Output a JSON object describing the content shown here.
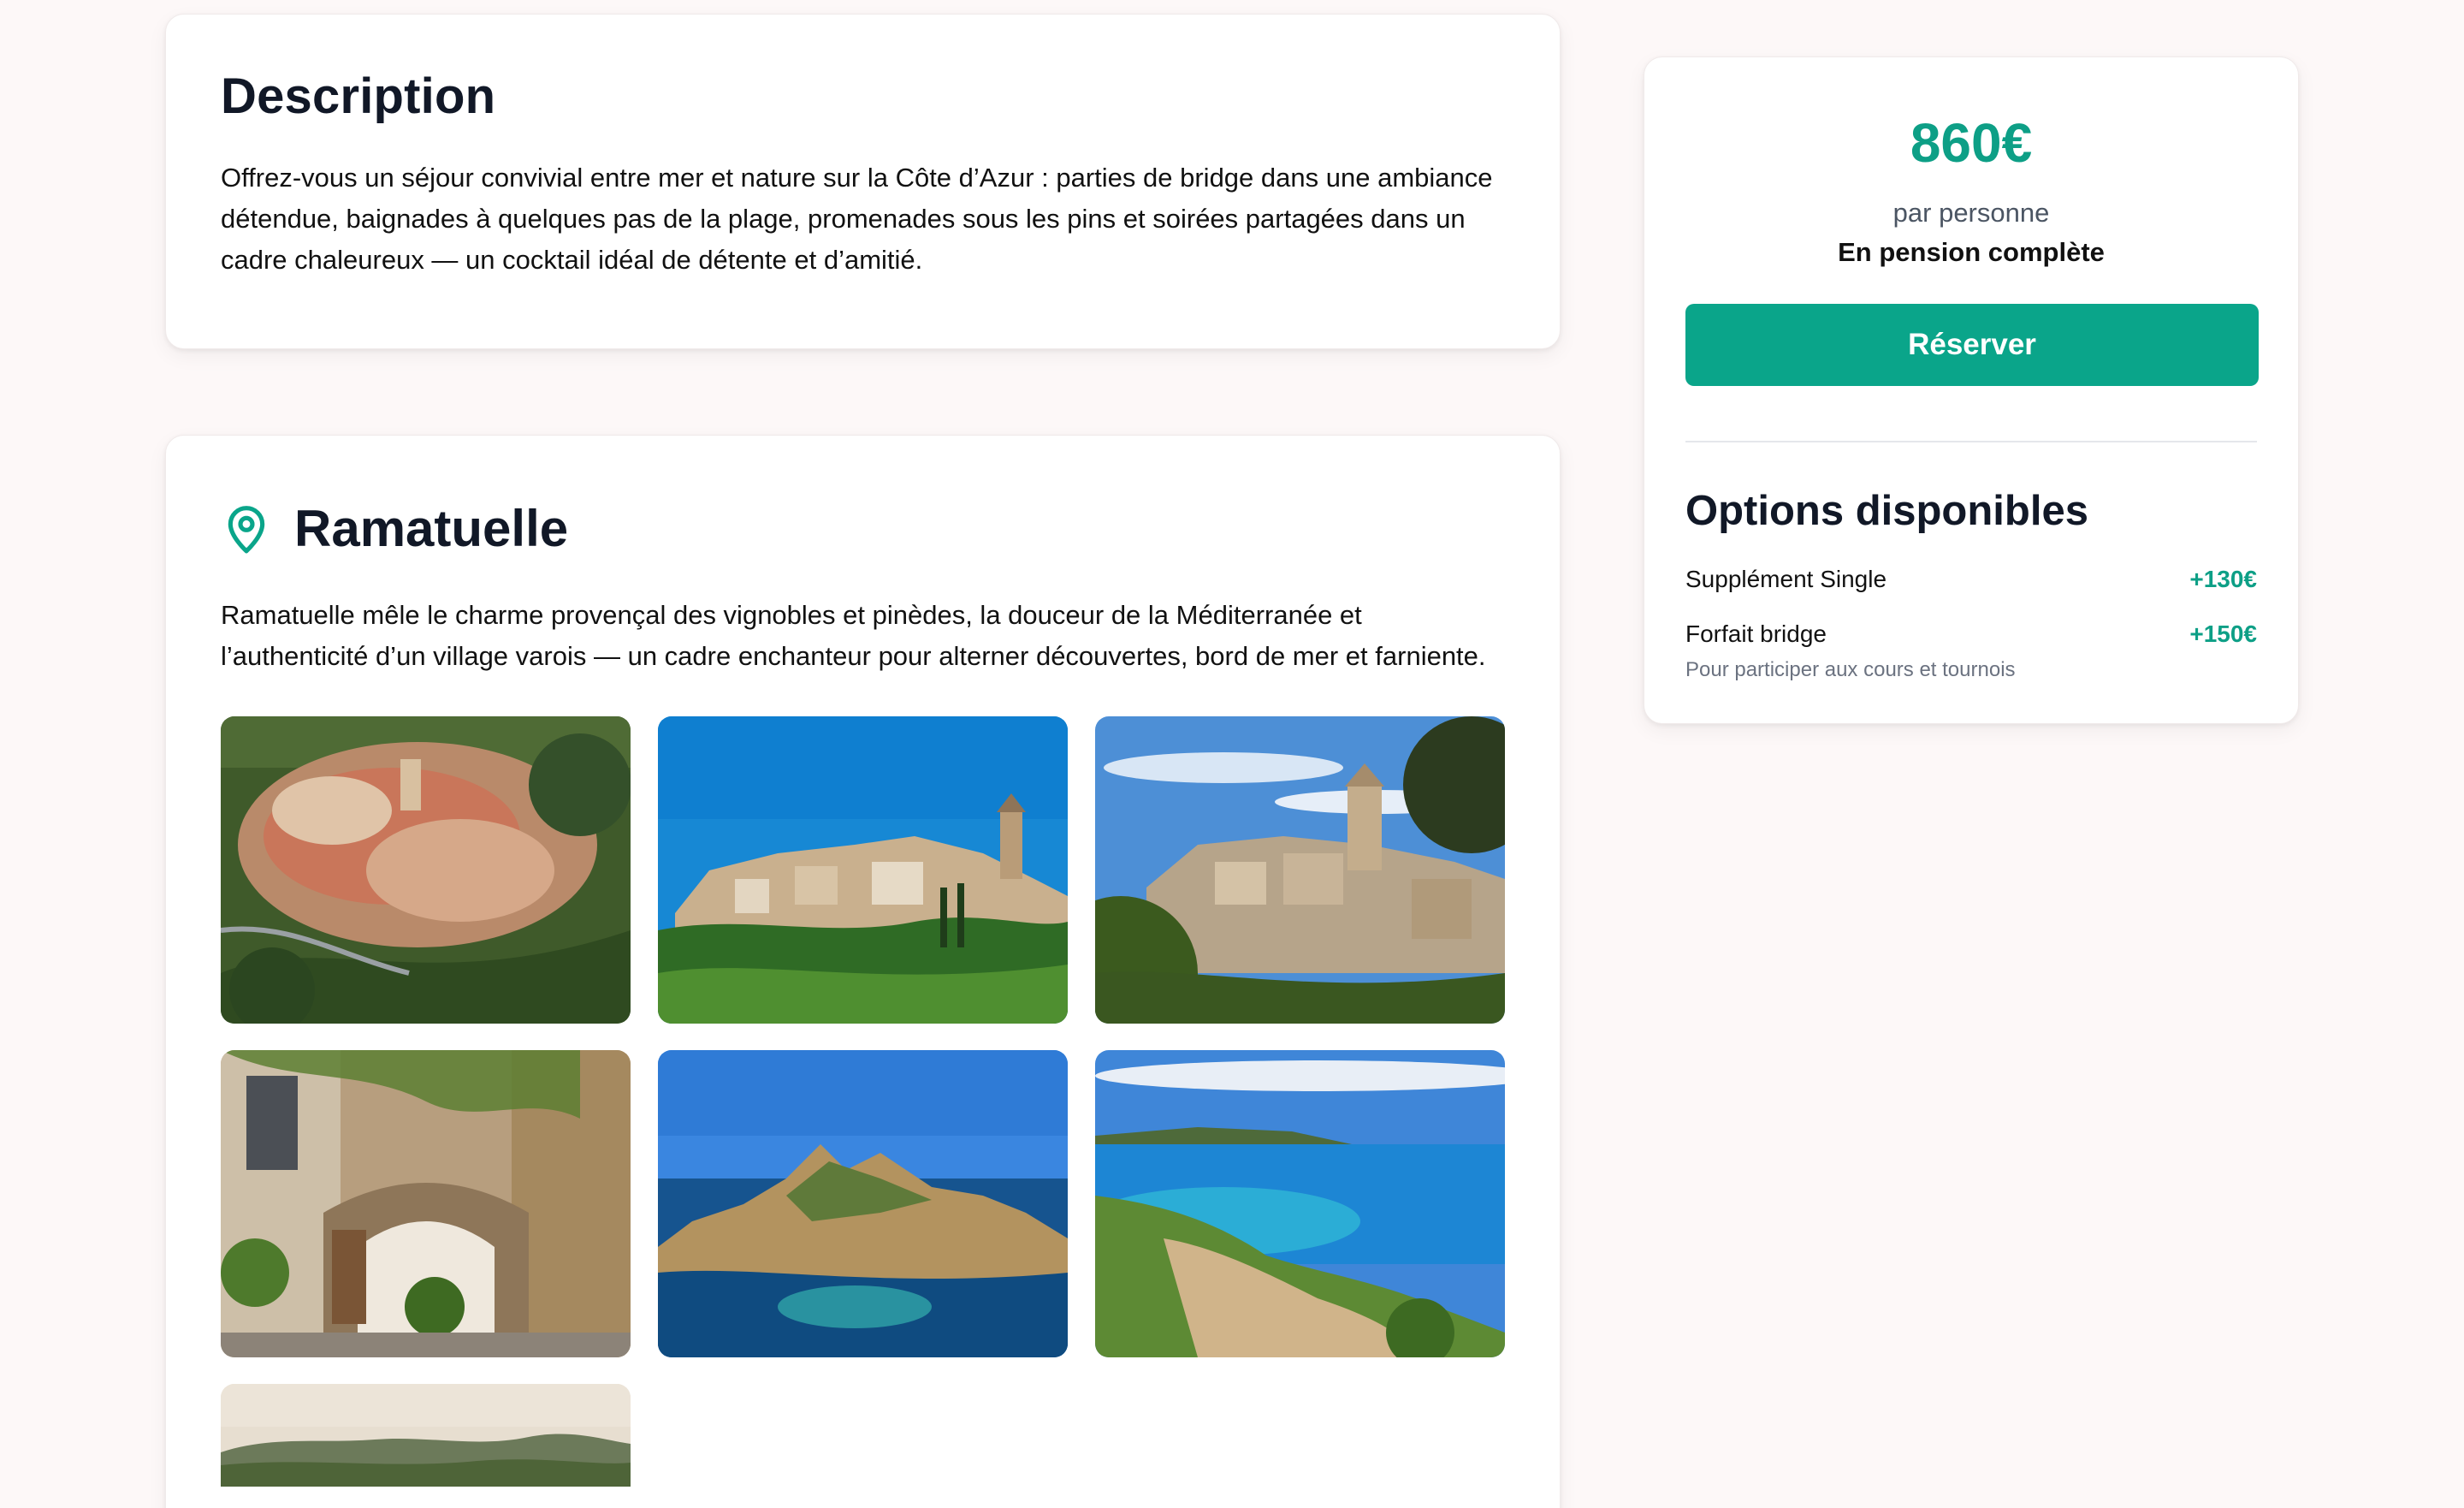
{
  "description": {
    "title": "Description",
    "text": "Offrez-vous un séjour convivial entre mer et nature sur la Côte d’Azur : parties de bridge dans une ambiance détendue, baignades à quelques pas de la plage, promenades sous les pins et soirées partagées dans un cadre chaleureux — un cocktail idéal de détente et d’amitié."
  },
  "place": {
    "icon": "map-pin-icon",
    "title": "Ramatuelle",
    "text": "Ramatuelle mêle le charme provençal des vignobles et pinèdes, la douceur de la Méditerranée et l’authenticité d’un village varois — un cadre enchanteur pour alterner découvertes, bord de mer et farniente.",
    "photos": [
      "aerial-village-photo",
      "hilltop-village-photo",
      "village-church-photo",
      "stone-archway-photo",
      "rocky-islet-photo",
      "turquoise-bay-photo",
      "hills-landscape-photo"
    ]
  },
  "booking": {
    "price": "860€",
    "per_person": "par personne",
    "board": "En pension complète",
    "reserve_label": "Réserver",
    "options_title": "Options disponibles",
    "options": [
      {
        "label": "Supplément Single",
        "price": "+130€",
        "note": ""
      },
      {
        "label": "Forfait bridge",
        "price": "+150€",
        "note": "Pour participer aux cours et tournois"
      }
    ]
  },
  "colors": {
    "accent": "#0aa58a",
    "price_text": "#0d9f86",
    "background": "#fdf8f8"
  }
}
